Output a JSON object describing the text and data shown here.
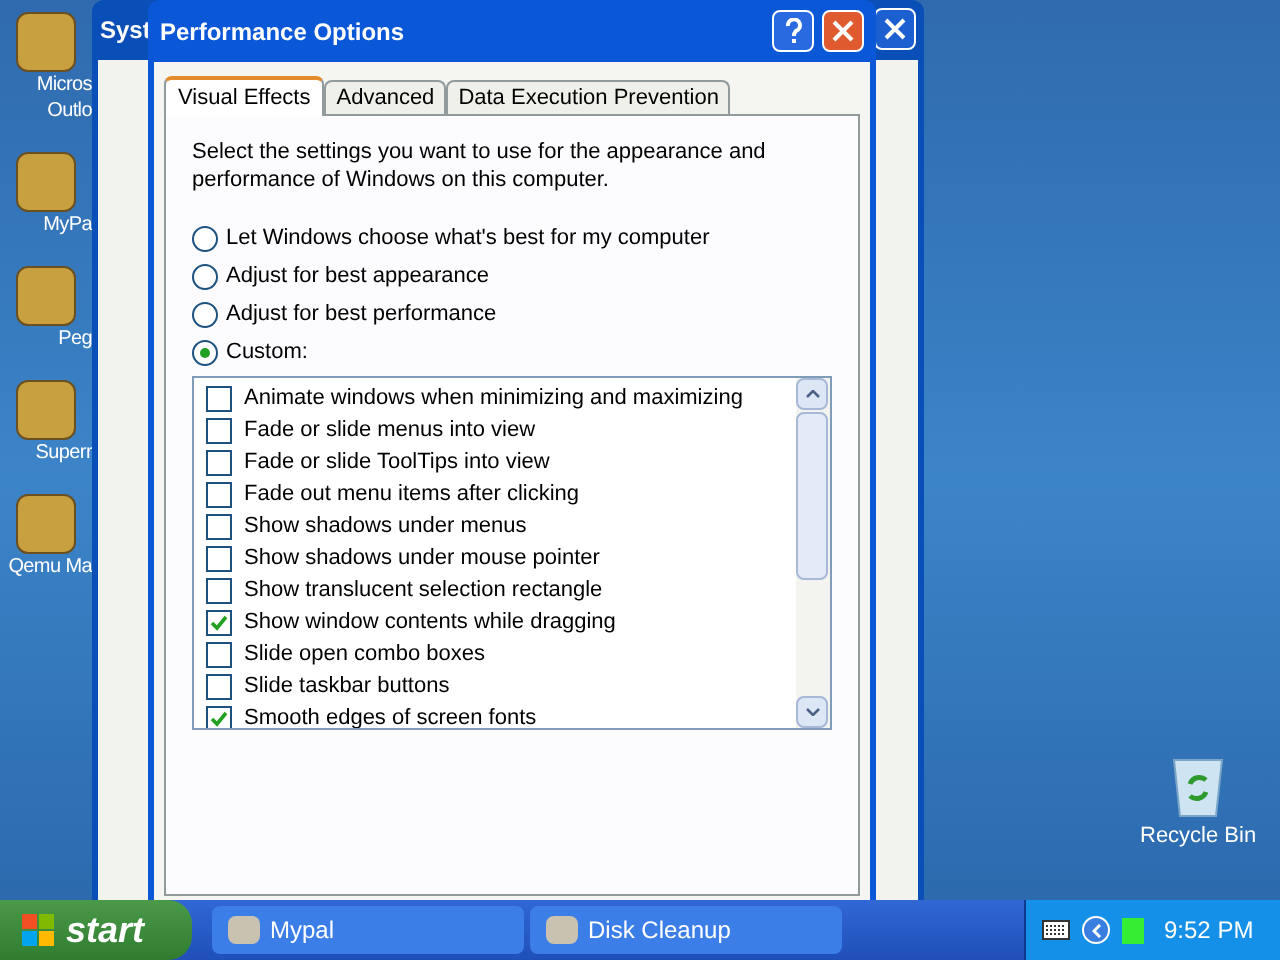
{
  "desktop_icons": [
    {
      "label": [
        "Micros",
        "Outlo"
      ]
    },
    {
      "label": [
        "MyPa"
      ]
    },
    {
      "label": [
        "Peg"
      ]
    },
    {
      "label": [
        "Superr"
      ]
    },
    {
      "label": [
        "Qemu Ma"
      ]
    }
  ],
  "recycle_bin": {
    "label": "Recycle Bin"
  },
  "background_window": {
    "title": "Syst"
  },
  "dialog": {
    "title": "Performance Options",
    "tabs": [
      {
        "label": "Visual Effects",
        "selected": true
      },
      {
        "label": "Advanced",
        "selected": false
      },
      {
        "label": "Data Execution Prevention",
        "selected": false
      }
    ],
    "intro": "Select the settings you want to use for the appearance and performance of Windows on this computer.",
    "options": [
      {
        "label": "Let Windows choose what's best for my computer",
        "selected": false
      },
      {
        "label": "Adjust for best appearance",
        "selected": false
      },
      {
        "label": "Adjust for best performance",
        "selected": false
      },
      {
        "label": "Custom:",
        "selected": true
      }
    ],
    "effects": [
      {
        "label": "Animate windows when minimizing and maximizing",
        "checked": false
      },
      {
        "label": "Fade or slide menus into view",
        "checked": false
      },
      {
        "label": "Fade or slide ToolTips into view",
        "checked": false
      },
      {
        "label": "Fade out menu items after clicking",
        "checked": false
      },
      {
        "label": "Show shadows under menus",
        "checked": false
      },
      {
        "label": "Show shadows under mouse pointer",
        "checked": false
      },
      {
        "label": "Show translucent selection rectangle",
        "checked": false
      },
      {
        "label": "Show window contents while dragging",
        "checked": true
      },
      {
        "label": "Slide open combo boxes",
        "checked": false
      },
      {
        "label": "Slide taskbar buttons",
        "checked": false
      },
      {
        "label": "Smooth edges of screen fonts",
        "checked": true
      }
    ]
  },
  "taskbar": {
    "start": "start",
    "tasks": [
      {
        "label": "Mypal"
      },
      {
        "label": "Disk Cleanup"
      }
    ],
    "clock": "9:52 PM"
  }
}
